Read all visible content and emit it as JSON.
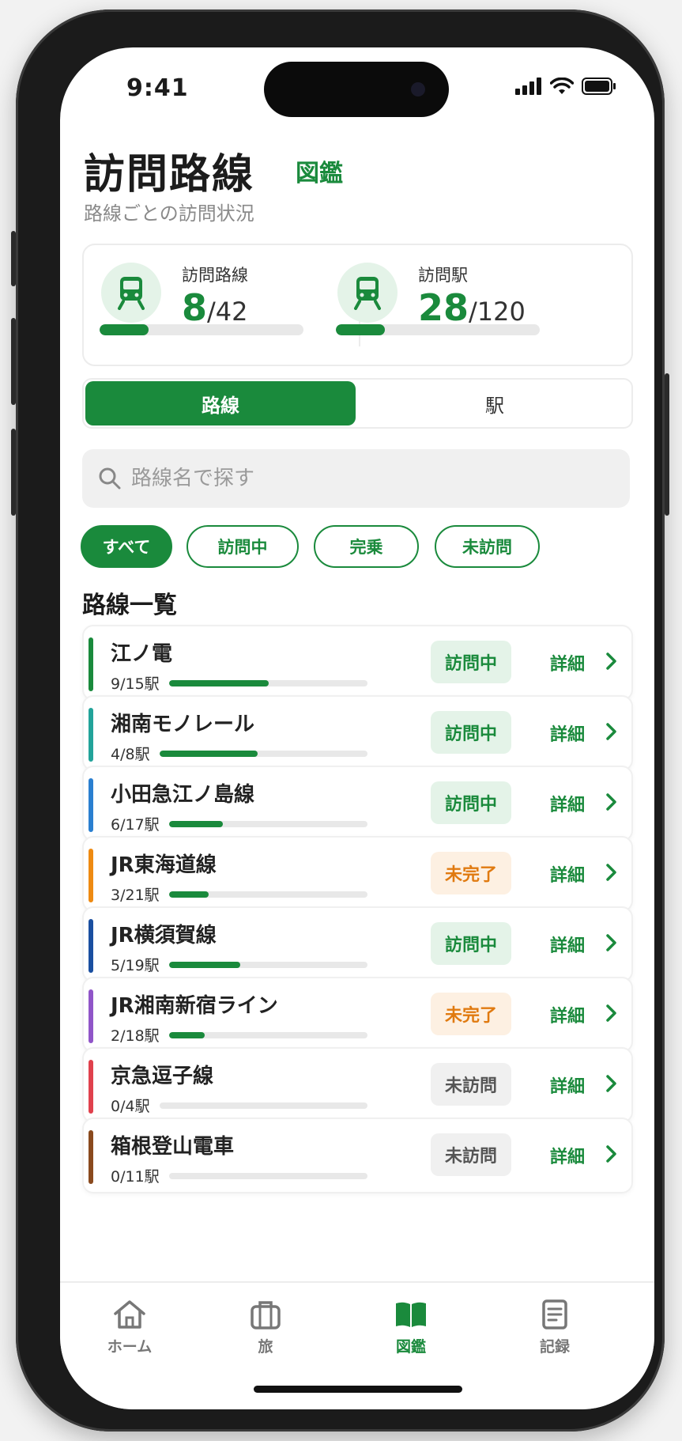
{
  "status_bar": {
    "time": "9:41"
  },
  "header": {
    "title": "訪問路線",
    "zukan_link": "図鑑",
    "subtitle": "路線ごとの訪問状況"
  },
  "summary": {
    "lines": {
      "label": "訪問路線",
      "visited": "8",
      "total": "/42",
      "progress": 0.24
    },
    "stations": {
      "label": "訪問駅",
      "visited": "28",
      "total": "/120",
      "progress": 0.24
    }
  },
  "segment": {
    "lines_label": "路線",
    "stations_label": "駅",
    "selected": "路線"
  },
  "search": {
    "placeholder": "路線名で探す",
    "value": ""
  },
  "filters": [
    {
      "label": "すべて",
      "active": true
    },
    {
      "label": "訪問中",
      "active": false
    },
    {
      "label": "完乗",
      "active": false
    },
    {
      "label": "未訪問",
      "active": false
    }
  ],
  "list_title": "路線一覧",
  "colors": {
    "accent": "#1a8a3c",
    "incomplete": "#e07a10"
  },
  "lines": [
    {
      "name": "江ノ電",
      "count": "9/15駅",
      "progress": 0.5,
      "status": "訪問中",
      "status_type": "visiting",
      "detail": "詳細",
      "color": "#1a8a3c"
    },
    {
      "name": "湘南モノレール",
      "count": "4/8駅",
      "progress": 0.47,
      "status": "訪問中",
      "status_type": "visiting",
      "detail": "詳細",
      "color": "#22a39a"
    },
    {
      "name": "小田急江ノ島線",
      "count": "6/17駅",
      "progress": 0.27,
      "status": "訪問中",
      "status_type": "visiting",
      "detail": "詳細",
      "color": "#2a7fd0"
    },
    {
      "name": "JR東海道線",
      "count": "3/21駅",
      "progress": 0.2,
      "status": "未完了",
      "status_type": "incomplete",
      "detail": "詳細",
      "color": "#ee8a12"
    },
    {
      "name": "JR横須賀線",
      "count": "5/19駅",
      "progress": 0.36,
      "status": "訪問中",
      "status_type": "visiting",
      "detail": "詳細",
      "color": "#1a4fa0"
    },
    {
      "name": "JR湘南新宿ライン",
      "count": "2/18駅",
      "progress": 0.18,
      "status": "未完了",
      "status_type": "incomplete",
      "detail": "詳細",
      "color": "#9055c8"
    },
    {
      "name": "京急逗子線",
      "count": "0/4駅",
      "progress": 0,
      "status": "未訪問",
      "status_type": "unvisited",
      "detail": "詳細",
      "color": "#e0414d"
    },
    {
      "name": "箱根登山電車",
      "count": "0/11駅",
      "progress": 0,
      "status": "未訪問",
      "status_type": "unvisited",
      "detail": "詳細",
      "color": "#8a4a1e"
    }
  ],
  "tabs": [
    {
      "label": "ホーム",
      "icon": "home-icon",
      "active": false
    },
    {
      "label": "旅",
      "icon": "suitcase-icon",
      "active": false
    },
    {
      "label": "図鑑",
      "icon": "book-icon",
      "active": true
    },
    {
      "label": "記録",
      "icon": "document-icon",
      "active": false
    }
  ]
}
